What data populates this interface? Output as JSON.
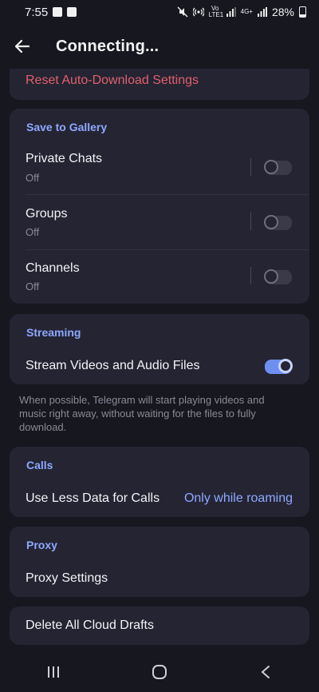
{
  "status_bar": {
    "time": "7:55",
    "battery": "28%",
    "volte": "Vo LTE1",
    "net": "4G+"
  },
  "header": {
    "title": "Connecting..."
  },
  "reset": {
    "label": "Reset Auto-Download Settings"
  },
  "save_to_gallery": {
    "heading": "Save to Gallery",
    "items": [
      {
        "label": "Private Chats",
        "status": "Off",
        "enabled": false
      },
      {
        "label": "Groups",
        "status": "Off",
        "enabled": false
      },
      {
        "label": "Channels",
        "status": "Off",
        "enabled": false
      }
    ]
  },
  "streaming": {
    "heading": "Streaming",
    "item_label": "Stream Videos and Audio Files",
    "enabled": true,
    "hint": "When possible, Telegram will start playing videos and music right away, without waiting for the files to fully download."
  },
  "calls": {
    "heading": "Calls",
    "item_label": "Use Less Data for Calls",
    "item_value": "Only while roaming"
  },
  "proxy": {
    "heading": "Proxy",
    "item_label": "Proxy Settings"
  },
  "drafts": {
    "label": "Delete All Cloud Drafts"
  },
  "colors": {
    "background": "#17171f",
    "card": "#242433",
    "accent": "#8fa8ff",
    "danger": "#e0606a"
  }
}
